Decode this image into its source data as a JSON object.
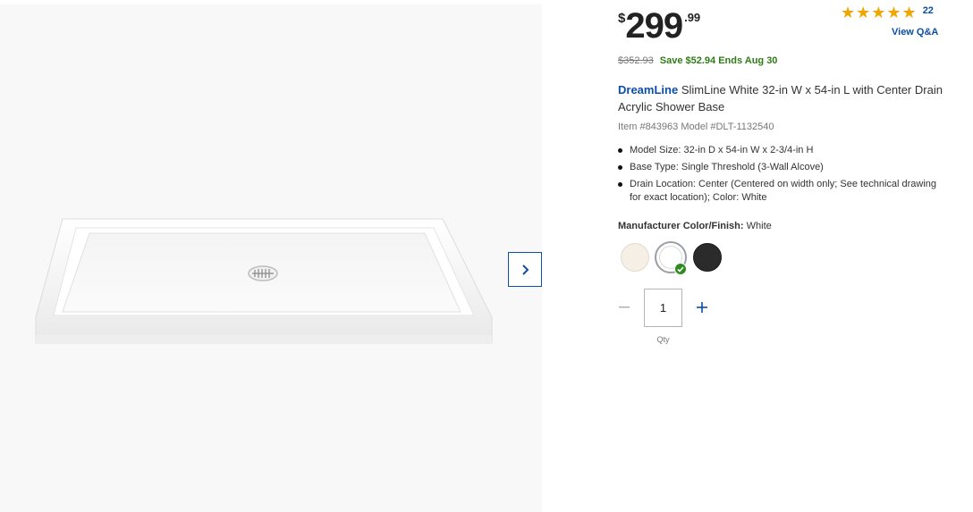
{
  "price": {
    "currency": "$",
    "dollars": "299",
    "cents": ".99"
  },
  "rating": {
    "stars_filled": 5,
    "count": "22",
    "view_qa": "View Q&A"
  },
  "promo": {
    "was_price": "$352.93",
    "save_text": "Save $52.94 Ends Aug 30"
  },
  "product": {
    "brand": "DreamLine",
    "title_rest": " SlimLine White 32-in W x 54-in L with Center Drain Acrylic Shower Base",
    "item_model": "Item #843963 Model #DLT-1132540"
  },
  "specs": [
    "Model Size: 32-in D x 54-in W x 2-3/4-in H",
    "Base Type: Single Threshold (3-Wall Alcove)",
    "Drain Location: Center (Centered on width only; See technical drawing for exact location); Color: White"
  ],
  "finish": {
    "label": "Manufacturer Color/Finish:",
    "value": "White"
  },
  "swatch_colors": {
    "almond": "#f5efe6",
    "white": "#ffffff",
    "black": "#2b2b2b"
  },
  "quantity": {
    "value": "1",
    "label": "Qty"
  },
  "colors": {
    "accent": "#0d4ea8",
    "save_green": "#2e7d14",
    "star": "#f0a500"
  }
}
